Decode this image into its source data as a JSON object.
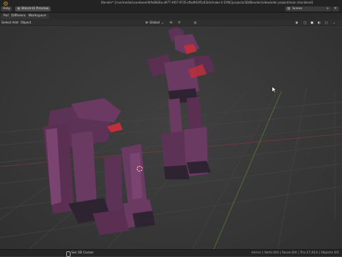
{
  "app": {
    "title": "Blender* [/run/media/scorebeam9/fe0826a-a977-4f07-9735-dfad903f5c63/dr/make it SYNC/projects/3D/Blender/sidewinder project/main char.blend]",
    "menu": {
      "help": "Help",
      "workspace": "Blend-Ui Preview",
      "scene": "Scene"
    }
  },
  "tabs": [
    {
      "label": "Pulldown"
    },
    {
      "label": "Difference"
    },
    {
      "label": "Workspace"
    }
  ],
  "toolbar": {
    "select": "Select",
    "add": "Add",
    "object": "Object",
    "orientation": "Global"
  },
  "status": {
    "left": "Set 3D Cursor",
    "right": "mirror | Verts:0/4 | Faces:0/4 | Tris:17,614 | Objects 0/1"
  },
  "colors": {
    "robot_body": "#6a3a62",
    "robot_dark": "#2e2330",
    "robot_accent": "#c0303a",
    "ui_accent": "#4772b3"
  }
}
